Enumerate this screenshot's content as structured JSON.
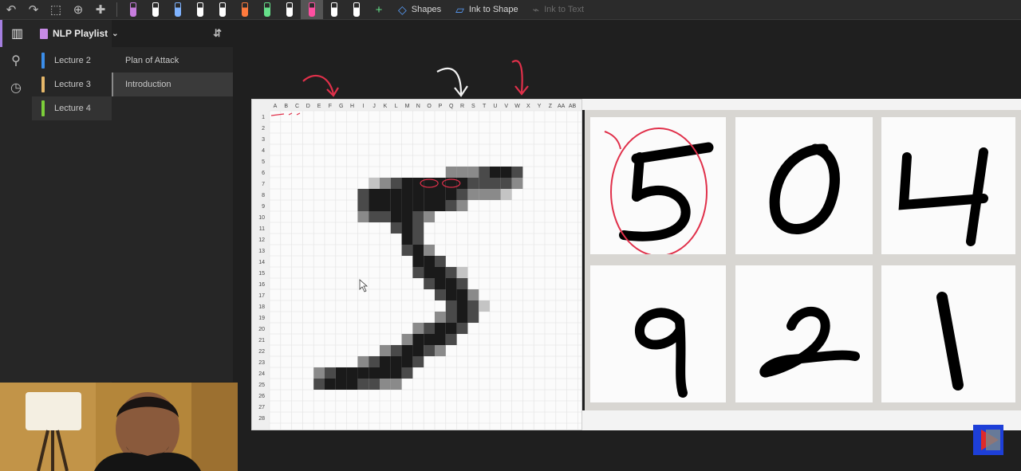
{
  "toolbar": {
    "shapes_label": "Shapes",
    "ink_to_shape_label": "Ink to Shape",
    "ink_to_text_label": "Ink to Text",
    "pen_colors": [
      "#c77dde",
      "#ffffff",
      "#7fb3ff",
      "#ffffff",
      "#ffffff",
      "#ff7a3d",
      "#66e08a",
      "#ffffff",
      "#ff4fa1",
      "#ffffff",
      "#ffffff"
    ]
  },
  "notebook": {
    "name": "NLP Playlist"
  },
  "sections": [
    {
      "label": "Lecture 2",
      "color": "#3b8eea"
    },
    {
      "label": "Lecture 3",
      "color": "#e6b86a"
    },
    {
      "label": "Lecture 4",
      "color": "#7ccf3a"
    }
  ],
  "pages": [
    {
      "label": "Plan of Attack"
    },
    {
      "label": "Introduction"
    }
  ],
  "spreadsheet": {
    "column_headers": [
      "A",
      "B",
      "C",
      "D",
      "E",
      "F",
      "G",
      "H",
      "I",
      "J",
      "K",
      "L",
      "M",
      "N",
      "O",
      "P",
      "Q",
      "R",
      "S",
      "T",
      "U",
      "V",
      "W",
      "X",
      "Y",
      "Z",
      "AA",
      "AB"
    ],
    "row_headers": [
      "1",
      "2",
      "3",
      "4",
      "5",
      "6",
      "7",
      "8",
      "9",
      "10",
      "11",
      "12",
      "13",
      "14",
      "15",
      "16",
      "17",
      "18",
      "19",
      "20",
      "21",
      "22",
      "23",
      "24",
      "25",
      "26",
      "27",
      "28"
    ]
  },
  "digit_grid": {
    "digits": [
      "5",
      "0",
      "4",
      "9",
      "2",
      "1"
    ]
  },
  "annotation_color": "#e0304a"
}
